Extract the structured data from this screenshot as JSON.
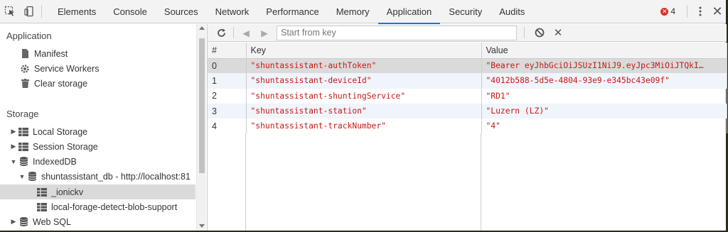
{
  "tabs": [
    "Elements",
    "Console",
    "Sources",
    "Network",
    "Performance",
    "Memory",
    "Application",
    "Security",
    "Audits"
  ],
  "active_tab": "Application",
  "error_count": "4",
  "sidebar": {
    "application_title": "Application",
    "application_items": [
      {
        "label": "Manifest",
        "icon": "document-icon"
      },
      {
        "label": "Service Workers",
        "icon": "gear-icon"
      },
      {
        "label": "Clear storage",
        "icon": "trash-icon"
      }
    ],
    "storage_title": "Storage",
    "storage_items": [
      {
        "label": "Local Storage",
        "icon": "grid-icon"
      },
      {
        "label": "Session Storage",
        "icon": "grid-icon"
      },
      {
        "label": "IndexedDB",
        "icon": "database-icon"
      },
      {
        "label": "shuntassistant_db - http://localhost:81",
        "icon": "database-icon"
      },
      {
        "label": "_ionickv",
        "icon": "grid-icon"
      },
      {
        "label": "local-forage-detect-blob-support",
        "icon": "grid-icon"
      },
      {
        "label": "Web SQL",
        "icon": "database-icon"
      }
    ]
  },
  "toolbar": {
    "filter_placeholder": "Start from key"
  },
  "table": {
    "headers": [
      "#",
      "Key",
      "Value"
    ],
    "rows": [
      {
        "index": "0",
        "key": "\"shuntassistant-authToken\"",
        "value": "\"Bearer eyJhbGciOiJSUzI1NiJ9.eyJpc3MiOiJTQkI…"
      },
      {
        "index": "1",
        "key": "\"shuntassistant-deviceId\"",
        "value": "\"4012b588-5d5e-4804-93e9-e345bc43e09f\""
      },
      {
        "index": "2",
        "key": "\"shuntassistant-shuntingService\"",
        "value": "\"RD1\""
      },
      {
        "index": "3",
        "key": "\"shuntassistant-station\"",
        "value": "\"Luzern (LZ)\""
      },
      {
        "index": "4",
        "key": "\"shuntassistant-trackNumber\"",
        "value": "\"4\""
      }
    ],
    "selected_row": "0"
  },
  "colors": {
    "accent": "#1a73e8",
    "string_value": "#c41a16",
    "error": "#d93025",
    "selection": "#dadada",
    "alt_row": "#f0f4fb"
  }
}
